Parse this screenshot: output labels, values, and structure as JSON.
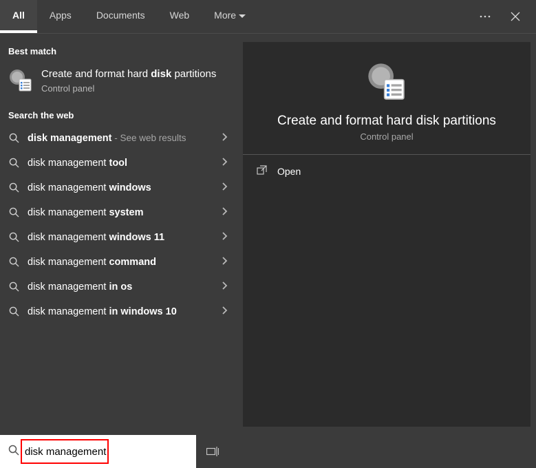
{
  "header": {
    "tabs": [
      {
        "label": "All",
        "active": true
      },
      {
        "label": "Apps",
        "active": false
      },
      {
        "label": "Documents",
        "active": false
      },
      {
        "label": "Web",
        "active": false
      },
      {
        "label": "More",
        "active": false,
        "dropdown": true
      }
    ]
  },
  "sections": {
    "best_match_heading": "Best match",
    "search_web_heading": "Search the web"
  },
  "best_match": {
    "title_pre": "Create and format hard ",
    "title_bold": "disk",
    "title_post": " partitions",
    "subtitle": "Control panel"
  },
  "web_results": [
    {
      "pre": "",
      "bold": "disk management",
      "post": "",
      "hint": " - See web results"
    },
    {
      "pre": "disk management ",
      "bold": "tool",
      "post": "",
      "hint": ""
    },
    {
      "pre": "disk management ",
      "bold": "windows",
      "post": "",
      "hint": ""
    },
    {
      "pre": "disk management ",
      "bold": "system",
      "post": "",
      "hint": ""
    },
    {
      "pre": "disk management ",
      "bold": "windows 11",
      "post": "",
      "hint": ""
    },
    {
      "pre": "disk management ",
      "bold": "command",
      "post": "",
      "hint": ""
    },
    {
      "pre": "disk management ",
      "bold": "in os",
      "post": "",
      "hint": ""
    },
    {
      "pre": "disk management ",
      "bold": "in windows 10",
      "post": "",
      "hint": ""
    }
  ],
  "preview": {
    "title": "Create and format hard disk partitions",
    "subtitle": "Control panel",
    "actions": [
      {
        "label": "Open"
      }
    ]
  },
  "search": {
    "value": "disk management"
  }
}
